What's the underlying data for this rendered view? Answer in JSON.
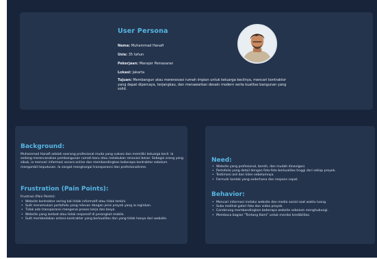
{
  "persona": {
    "title": "User Persona",
    "name_label": "Nama:",
    "name_value": "Muhammad Hanafi",
    "age_label": "Usia:",
    "age_value": "35 tahun",
    "job_label": "Pekerjaan:",
    "job_value": "Manajer Pemasaran",
    "location_label": "Lokasi:",
    "location_value": "Jakarta",
    "goal_label": "Tujuan:",
    "goal_value": "Membangun atau merenovasi rumah impian untuk keluarga kecilnya, mencari kontraktor yang dapat dipercaya, terjangkau, dan menawarkan desain modern serta kualitas bangunan yang solid."
  },
  "background": {
    "title": "Background:",
    "text": "Muhammad Hanafi adalah seorang profesional muda yang sukses dan memiliki keluarga kecil. Ia sedang merencanakan pembangunan rumah baru atau melakukan renovasi besar. Sebagai orang yang sibuk, ia mencari informasi secara online dan membandingkan beberapa kontraktor sebelum mengambil keputusan. Ia sangat menghargai transparansi dan profesionalisme."
  },
  "frustration": {
    "title": "Frustration (Pain Points):",
    "intro": "Frustrasi (Pain Points):",
    "items": [
      "Website kontraktor sering kali tidak informatif atau tidak terkini.",
      "Sulit menemukan portofolio yang relevan dengan jenis proyek yang ia inginkan.",
      "Tidak ada transparansi mengenai proses kerja dan biaya.",
      "Website yang lambat atau tidak responsif di perangkat mobile.",
      "Sulit membedakan antara kontraktor yang berkualitas dan yang tidak hanya dari website."
    ]
  },
  "need": {
    "title": "Need:",
    "items": [
      "Website yang profesional, bersih, dan mudah dinavigasi.",
      "Portofolio yang detail dengan foto-foto berkualitas tinggi dari setiap proyek.",
      "Testimoni asli dari klien sebelumnya.",
      "Formulir kontak yang sederhana dan respons cepat."
    ]
  },
  "behavior": {
    "title": "Behavior:",
    "items": [
      "Mencari informasi melalui website dan media sosial saat waktu luang.",
      "Suka melihat galeri foto dan video proyek.",
      "Cenderung membandingkan beberapa website sebelum menghubungi.",
      "Membaca bagian \"Tentang Kami\" untuk menilai kredibilitas."
    ]
  },
  "colors": {
    "background": "#18243a",
    "card": "#25344d",
    "accent": "#56b6e4",
    "text": "#e6ebf3"
  },
  "icons": {
    "avatar": "user-portrait-photo"
  }
}
